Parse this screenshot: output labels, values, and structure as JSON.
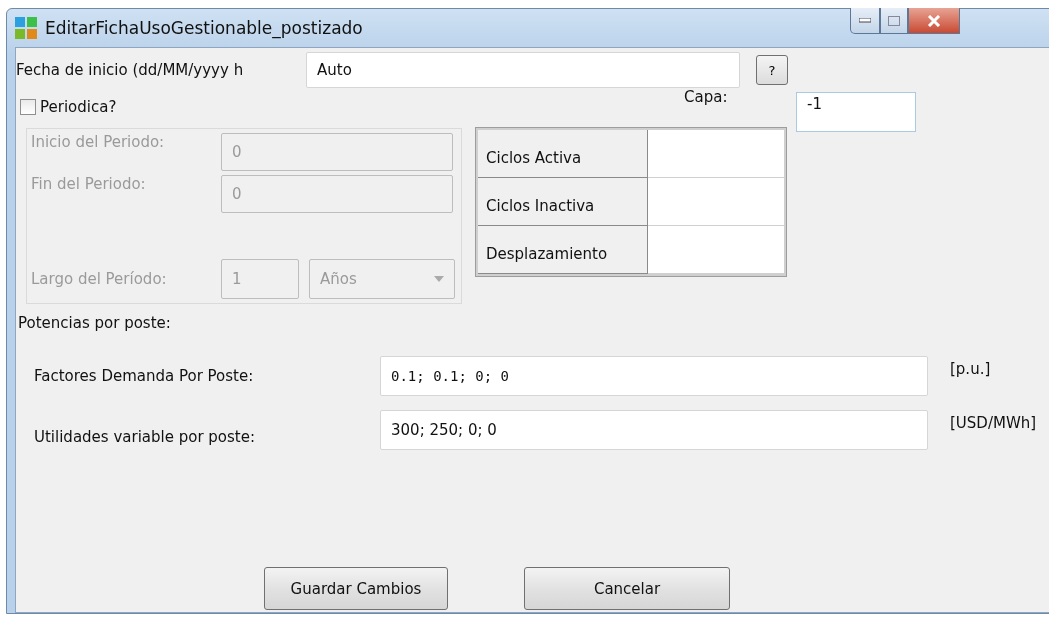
{
  "window": {
    "title": "EditarFichaUsoGestionable_postizado"
  },
  "start_date": {
    "label": "Fecha de inicio (dd/MM/yyyy h",
    "value": "Auto",
    "help_button": "?"
  },
  "capa": {
    "label": "Capa:",
    "value": "-1"
  },
  "periodic": {
    "label": "Periodica?",
    "checked": false
  },
  "period": {
    "disabled": true,
    "fields": [
      {
        "label": "Inicio del Periodo:",
        "value": "0"
      },
      {
        "label": "Fin del Periodo:",
        "value": "0"
      }
    ],
    "length": {
      "label": "Largo del Período:",
      "value": "1",
      "unit": "Años"
    }
  },
  "cycles_table": {
    "rows": [
      {
        "header": "Ciclos Activa"
      },
      {
        "header": "Ciclos Inactiva"
      },
      {
        "header": "Desplazamiento"
      }
    ]
  },
  "section_label": "Potencias por poste:",
  "post_fields": [
    {
      "label": "Factores Demanda Por Poste:",
      "value": "0.1; 0.1; 0; 0",
      "unit": "[p.u.]"
    },
    {
      "label": "Utilidades variable por poste:",
      "value": "300; 250; 0; 0",
      "unit": "[USD/MWh]"
    }
  ],
  "buttons": [
    "Guardar Cambios",
    "Cancelar"
  ]
}
